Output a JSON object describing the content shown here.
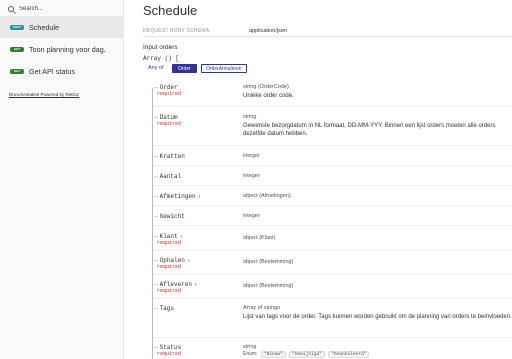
{
  "sidebar": {
    "search_placeholder": "Search...",
    "items": [
      {
        "method": "POST",
        "label": "Schedule",
        "active": true
      },
      {
        "method": "GET",
        "label": "Toon planning voor dag.",
        "active": false
      },
      {
        "method": "GET",
        "label": "Get API status",
        "active": false
      }
    ],
    "footer_link": "Documentation Powered by ReDoc"
  },
  "main": {
    "title": "Schedule",
    "request_body_label": "REQUEST BODY SCHEMA:",
    "request_body_value": "application/json",
    "input_label": "Input orders",
    "array_label": "Array () [",
    "anyof_label": "Any of",
    "anyof_options": [
      "Order",
      "OrderAnnuleren"
    ],
    "properties": [
      {
        "name": "Order",
        "required": "required",
        "expandable": false,
        "type": "string (OrderCode)",
        "desc": "Unieke order code."
      },
      {
        "name": "Datum",
        "required": "required",
        "expandable": false,
        "type": "string",
        "desc": "Gewenste bezorgdatum in NL formaat, DD-MM-YYY. Binnen een lijst orders moeten alle orders dezelfde datum hebben."
      },
      {
        "name": "Kratten",
        "required": "",
        "expandable": false,
        "type": "integer",
        "desc": ""
      },
      {
        "name": "Aantal",
        "required": "",
        "expandable": false,
        "type": "integer",
        "desc": ""
      },
      {
        "name": "Afmetingen",
        "required": "",
        "expandable": true,
        "type": "object (Afmetingen)",
        "desc": ""
      },
      {
        "name": "Gewicht",
        "required": "",
        "expandable": false,
        "type": "integer",
        "desc": ""
      },
      {
        "name": "Klant",
        "required": "required",
        "expandable": true,
        "type": "object (Klant)",
        "desc": ""
      },
      {
        "name": "Ophalen",
        "required": "required",
        "expandable": true,
        "type": "object (Bestemming)",
        "desc": ""
      },
      {
        "name": "Afleveren",
        "required": "required",
        "expandable": true,
        "type": "object (Bestemming)",
        "desc": ""
      },
      {
        "name": "Tags",
        "required": "",
        "expandable": false,
        "type": "Array of strings",
        "desc": "Lijst van tags voor de order. Tags kunnen worden gebruikt om de planning van orders te beinvloeden."
      },
      {
        "name": "Status",
        "required": "required",
        "expandable": false,
        "type": "string",
        "desc": ""
      }
    ],
    "enum_label": "Enum:",
    "enum_values": [
      "\"Nieuw\"",
      "\"Gewijzigd\"",
      "\"Geannuleerd\""
    ]
  },
  "icons": {
    "search": "search-icon",
    "chevron": "chevron-right-icon"
  },
  "colors": {
    "accent": "#32329f",
    "post": "#248fb2",
    "get": "#2f8132",
    "required": "#d41f1c"
  }
}
